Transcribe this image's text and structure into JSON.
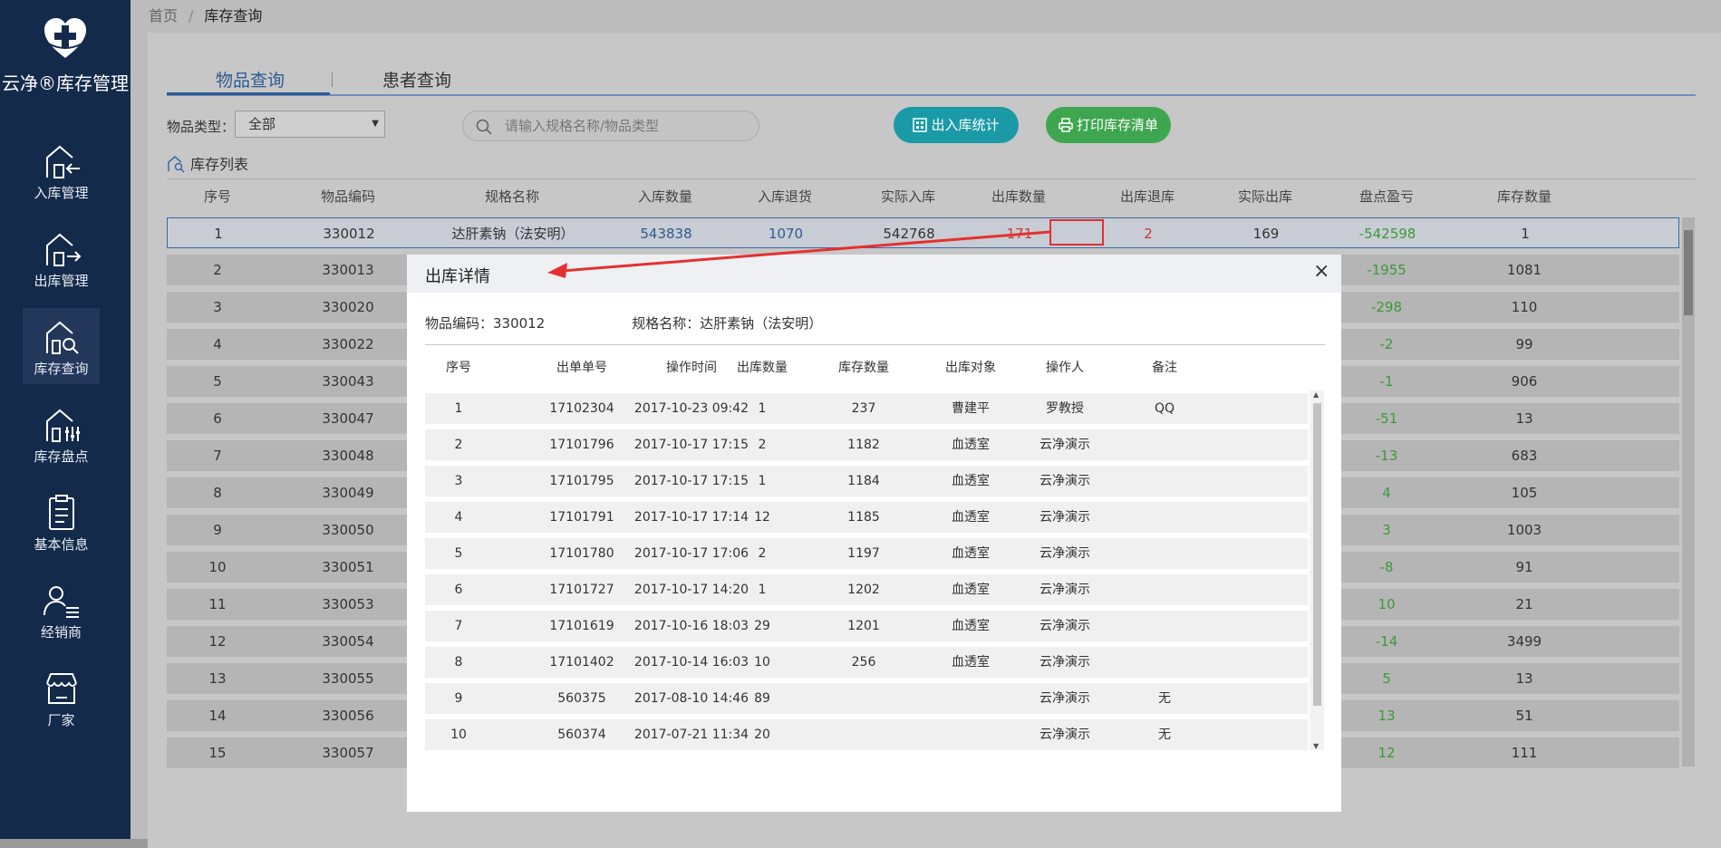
{
  "sidebar": {
    "app_title": "云净®库存管理",
    "items": [
      {
        "label": "入库管理",
        "icon": "inbound-icon"
      },
      {
        "label": "出库管理",
        "icon": "outbound-icon"
      },
      {
        "label": "库存查询",
        "icon": "inventory-search-icon",
        "active": true
      },
      {
        "label": "库存盘点",
        "icon": "stocktake-icon"
      },
      {
        "label": "基本信息",
        "icon": "clipboard-icon"
      },
      {
        "label": "经销商",
        "icon": "dealer-icon"
      },
      {
        "label": "厂家",
        "icon": "factory-icon"
      }
    ]
  },
  "breadcrumb": {
    "home": "首页",
    "sep": "/",
    "current": "库存查询"
  },
  "tabs": [
    "物品查询",
    "患者查询"
  ],
  "filter": {
    "label": "物品类型：",
    "value": "全部"
  },
  "search": {
    "placeholder": "请输入规格名称/物品类型"
  },
  "buttons": {
    "stats": "出入库统计",
    "print": "打印库存清单"
  },
  "list_title": "库存列表",
  "table": {
    "columns": [
      "序号",
      "物品编码",
      "规格名称",
      "入库数量",
      "入库退货",
      "实际入库",
      "出库数量",
      "出库退库",
      "实际出库",
      "盘点盈亏",
      "库存数量"
    ],
    "rows": [
      {
        "no": "1",
        "code": "330012",
        "name": "达肝素钠（法安明）",
        "in_qty": "543838",
        "in_ret": "1070",
        "in_real": "542768",
        "out_qty": "171",
        "out_ret": "2",
        "out_real": "169",
        "diff": "-542598",
        "stock": "1"
      },
      {
        "no": "2",
        "code": "330013",
        "diff": "-1955",
        "stock": "1081"
      },
      {
        "no": "3",
        "code": "330020",
        "diff": "-298",
        "stock": "110"
      },
      {
        "no": "4",
        "code": "330022",
        "diff": "-2",
        "stock": "99"
      },
      {
        "no": "5",
        "code": "330043",
        "diff": "-1",
        "stock": "906"
      },
      {
        "no": "6",
        "code": "330047",
        "diff": "-51",
        "stock": "13"
      },
      {
        "no": "7",
        "code": "330048",
        "diff": "-13",
        "stock": "683"
      },
      {
        "no": "8",
        "code": "330049",
        "diff": "4",
        "stock": "105"
      },
      {
        "no": "9",
        "code": "330050",
        "diff": "3",
        "stock": "1003"
      },
      {
        "no": "10",
        "code": "330051",
        "diff": "-8",
        "stock": "91"
      },
      {
        "no": "11",
        "code": "330053",
        "diff": "10",
        "stock": "21"
      },
      {
        "no": "12",
        "code": "330054",
        "diff": "-14",
        "stock": "3499"
      },
      {
        "no": "13",
        "code": "330055",
        "diff": "5",
        "stock": "13"
      },
      {
        "no": "14",
        "code": "330056",
        "diff": "13",
        "stock": "51"
      },
      {
        "no": "15",
        "code": "330057",
        "diff": "12",
        "stock": "111"
      }
    ]
  },
  "modal": {
    "title": "出库详情",
    "close": "×",
    "code_label": "物品编码：330012",
    "name_label": "规格名称：达肝素钠（法安明）",
    "columns": [
      "序号",
      "出单单号",
      "操作时间",
      "出库数量",
      "库存数量",
      "出库对象",
      "操作人",
      "备注"
    ],
    "rows": [
      [
        "1",
        "17102304",
        "2017-10-23 09:42",
        "1",
        "237",
        "曹建平",
        "罗教授",
        "QQ"
      ],
      [
        "2",
        "17101796",
        "2017-10-17 17:15",
        "2",
        "1182",
        "血透室",
        "云净演示",
        ""
      ],
      [
        "3",
        "17101795",
        "2017-10-17 17:15",
        "1",
        "1184",
        "血透室",
        "云净演示",
        ""
      ],
      [
        "4",
        "17101791",
        "2017-10-17 17:14",
        "12",
        "1185",
        "血透室",
        "云净演示",
        ""
      ],
      [
        "5",
        "17101780",
        "2017-10-17 17:06",
        "2",
        "1197",
        "血透室",
        "云净演示",
        ""
      ],
      [
        "6",
        "17101727",
        "2017-10-17 14:20",
        "1",
        "1202",
        "血透室",
        "云净演示",
        ""
      ],
      [
        "7",
        "17101619",
        "2017-10-16 18:03",
        "29",
        "1201",
        "血透室",
        "云净演示",
        ""
      ],
      [
        "8",
        "17101402",
        "2017-10-14 16:03",
        "10",
        "256",
        "血透室",
        "云净演示",
        ""
      ],
      [
        "9",
        "560375",
        "2017-08-10 14:46",
        "89",
        "",
        "",
        "云净演示",
        "无"
      ],
      [
        "10",
        "560374",
        "2017-07-21 11:34",
        "20",
        "",
        "",
        "云净演示",
        "无"
      ]
    ]
  },
  "colors": {
    "sidebar": "#142a4a",
    "accent": "#2e5b93",
    "highlight": "#e03030",
    "positive": "#3a9a3a",
    "negative": "#c83a3a"
  }
}
